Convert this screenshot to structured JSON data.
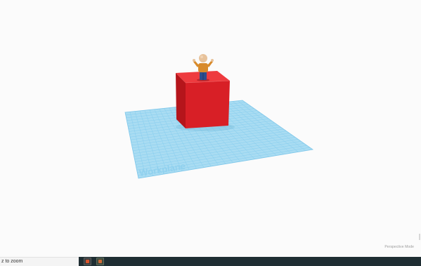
{
  "viewport": {
    "workplane_label": "Workplane",
    "perspective_label": "Perspective Mode"
  },
  "status_bar": {
    "text": "z to zoom"
  },
  "taskbar": {
    "items": [
      {
        "name": "app-icon-1"
      },
      {
        "name": "app-icon-2"
      }
    ]
  },
  "colors": {
    "workplane": "#a9dcf2",
    "workplane_grid": "#7cc6ea",
    "box_front": "#d81f26",
    "box_top": "#ee3b3f",
    "box_side": "#b5151b",
    "taskbar": "#1f2e33"
  }
}
